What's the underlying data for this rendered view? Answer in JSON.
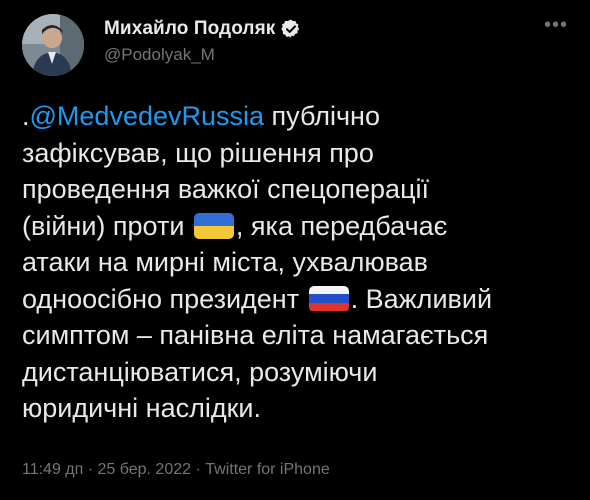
{
  "author": {
    "display_name": "Михайло Подоляк",
    "handle": "@Podolyak_M",
    "avatar": "profile-photo",
    "verified_icon": "verified-badge-icon"
  },
  "more_icon": "more-options-icon",
  "tweet": {
    "lines": [
      {
        "prefix": ".",
        "mention": "@MedvedevRussia",
        "text": " публічно"
      },
      {
        "text": "зафіксував, що рішення про"
      },
      {
        "text": "проведення важкої спецоперації"
      },
      {
        "text_before": "(війни) проти ",
        "flag": "ukraine-flag",
        "text_after": ", яка передбачає"
      },
      {
        "text": "атаки на мирні міста, ухвалював"
      },
      {
        "text_before": "одноосібно президент ",
        "flag": "russia-flag",
        "text_after": ". Важливий"
      },
      {
        "text": "симптом – панівна еліта намагається"
      },
      {
        "text": "дистанціюватися, розуміючи"
      },
      {
        "text": "юридичні наслідки."
      }
    ]
  },
  "meta": {
    "time": "11:49 дп",
    "separator": " · ",
    "date": "25 бер. 2022",
    "source": "Twitter for iPhone"
  },
  "colors": {
    "background": "#000000",
    "text": "#e7e9ea",
    "secondary": "#71767b",
    "link": "#1d9bf0",
    "verified": "#e7e9ea"
  }
}
